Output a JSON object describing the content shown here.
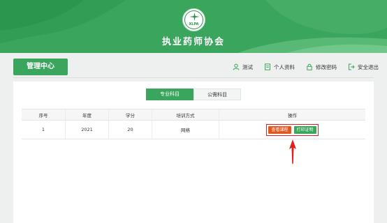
{
  "header": {
    "org_title": "执业药师协会",
    "logo_abbr": "XLPA",
    "brand_color": "#3aa55c"
  },
  "nav": {
    "section_title": "管理中心",
    "links": [
      {
        "label": "测试",
        "icon": "user-icon"
      },
      {
        "label": "个人资料",
        "icon": "document-icon"
      },
      {
        "label": "修改密码",
        "icon": "lock-icon"
      },
      {
        "label": "安全退出",
        "icon": "logout-icon"
      }
    ]
  },
  "tabs": [
    {
      "label": "专业科目",
      "active": true
    },
    {
      "label": "公需科目",
      "active": false
    }
  ],
  "table": {
    "columns": [
      "序号",
      "年度",
      "学分",
      "培训方式",
      "操作"
    ],
    "rows": [
      {
        "index": "1",
        "year": "2021",
        "credits": "20",
        "method": "网络",
        "actions": [
          "查看课程",
          "打印证明"
        ]
      }
    ]
  },
  "annotation": {
    "highlight_color": "#e02020"
  }
}
